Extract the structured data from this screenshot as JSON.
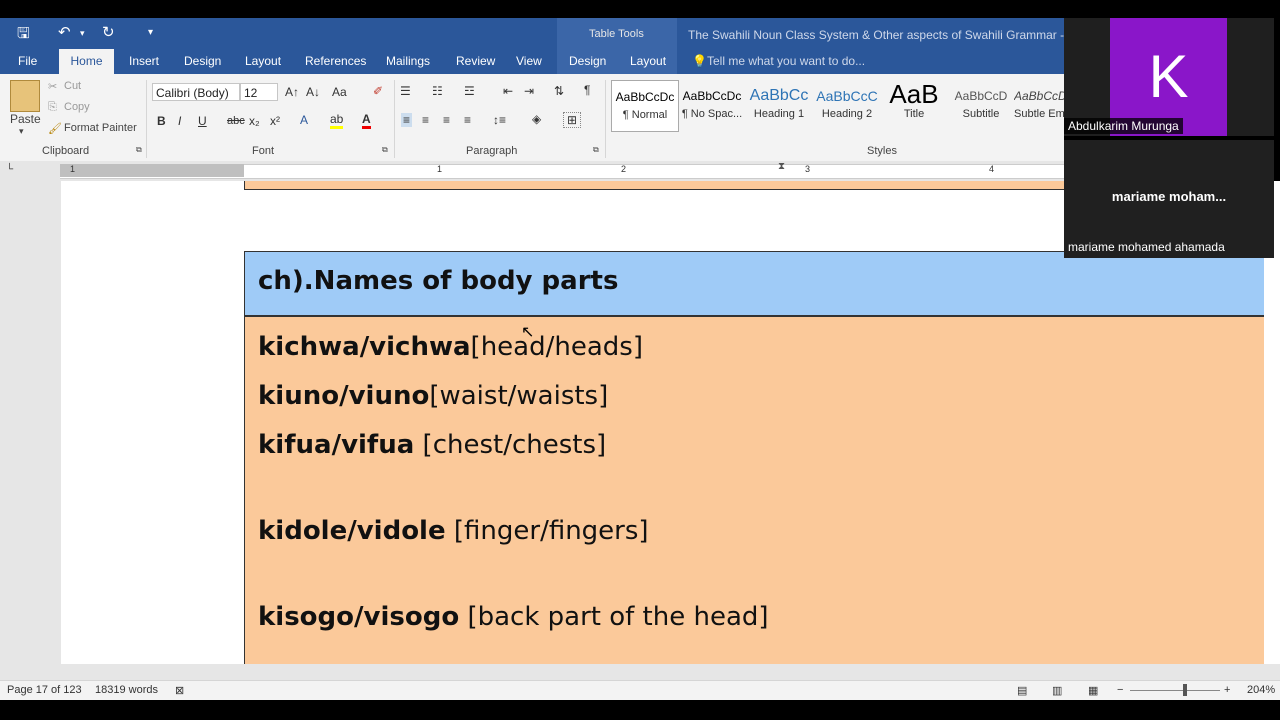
{
  "title_bar": {
    "context_group": "Table Tools",
    "document_title": "The Swahili Noun Class System & Other aspects of Swahili Grammar - Word"
  },
  "tabs": [
    "File",
    "Home",
    "Insert",
    "Design",
    "Layout",
    "References",
    "Mailings",
    "Review",
    "View",
    "Design",
    "Layout"
  ],
  "active_tab": "Home",
  "tell_me": "Tell me what you want to do...",
  "clipboard": {
    "paste": "Paste",
    "cut": "Cut",
    "copy": "Copy",
    "format_painter": "Format Painter",
    "group": "Clipboard"
  },
  "font": {
    "family": "Calibri (Body)",
    "size": "12",
    "group": "Font",
    "bold": "B",
    "italic": "I",
    "underline": "U",
    "strike": "abc",
    "sub": "x₂",
    "sup": "x²",
    "case": "Aa"
  },
  "paragraph": {
    "group": "Paragraph"
  },
  "styles": {
    "group": "Styles",
    "items": [
      {
        "preview": "AaBbCcDc",
        "name": "¶ Normal"
      },
      {
        "preview": "AaBbCcDc",
        "name": "¶ No Spac..."
      },
      {
        "preview": "AaBbCc",
        "name": "Heading 1"
      },
      {
        "preview": "AaBbCcC",
        "name": "Heading 2"
      },
      {
        "preview": "AaB",
        "name": "Title"
      },
      {
        "preview": "AaBbCcD",
        "name": "Subtitle"
      },
      {
        "preview": "AaBbCcD",
        "name": "Subtle Em"
      }
    ]
  },
  "ruler": {
    "numbers": [
      "1",
      "1",
      "2",
      "3",
      "4"
    ]
  },
  "document": {
    "heading": "ch).Names of body parts",
    "entries": [
      {
        "bold": "kichwa/vichwa",
        "rest": "[head/heads]"
      },
      {
        "bold": "kiuno/viuno",
        "rest": "[waist/waists]"
      },
      {
        "bold": "kifua/vifua",
        "rest": " [chest/chests]"
      },
      {
        "bold": "kidole/vidole",
        "rest": " [finger/fingers]"
      },
      {
        "bold": "kisogo/visogo",
        "rest": " [back part of the head]"
      }
    ]
  },
  "participants": [
    {
      "initial": "K",
      "name": "Abdulkarim Murunga",
      "color": "#8a16c9"
    },
    {
      "display": "mariame  moham...",
      "name": "mariame mohamed ahamada"
    }
  ],
  "status": {
    "page": "Page 17 of 123",
    "words": "18319 words",
    "zoom": "204%"
  }
}
